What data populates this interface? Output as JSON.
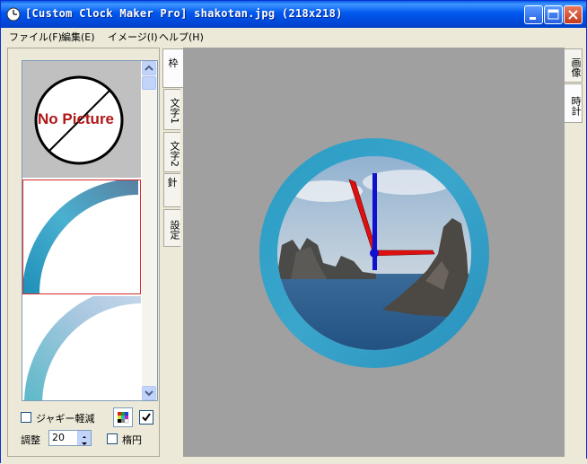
{
  "window": {
    "title": "[Custom Clock Maker Pro] shakotan.jpg (218x218)",
    "title_color": "#0054e3"
  },
  "menu": [
    {
      "label": "ファイル(F)"
    },
    {
      "label": "編集(E)"
    },
    {
      "label": "イメージ(I)"
    },
    {
      "label": "ヘルプ(H)"
    }
  ],
  "frame_list": {
    "no_picture_label": "No Picture",
    "selected_border_color": "#d62828"
  },
  "controls": {
    "jaggy_label": "ジャギー軽減",
    "adjust_label": "調整",
    "adjust_value": "20",
    "ellipse_label": "楕円"
  },
  "left_tabs": [
    {
      "label": "枠"
    },
    {
      "label": "文字1"
    },
    {
      "label": "文字2"
    },
    {
      "label": "針"
    },
    {
      "label": "設定"
    }
  ],
  "right_tabs": [
    {
      "label": "画像"
    },
    {
      "label": "時計"
    }
  ],
  "colors": {
    "ring": "#2a9cc4",
    "hour_hand": "#e01010",
    "minute_hand": "#1010d0",
    "canvas_bg": "#a0a0a0"
  }
}
